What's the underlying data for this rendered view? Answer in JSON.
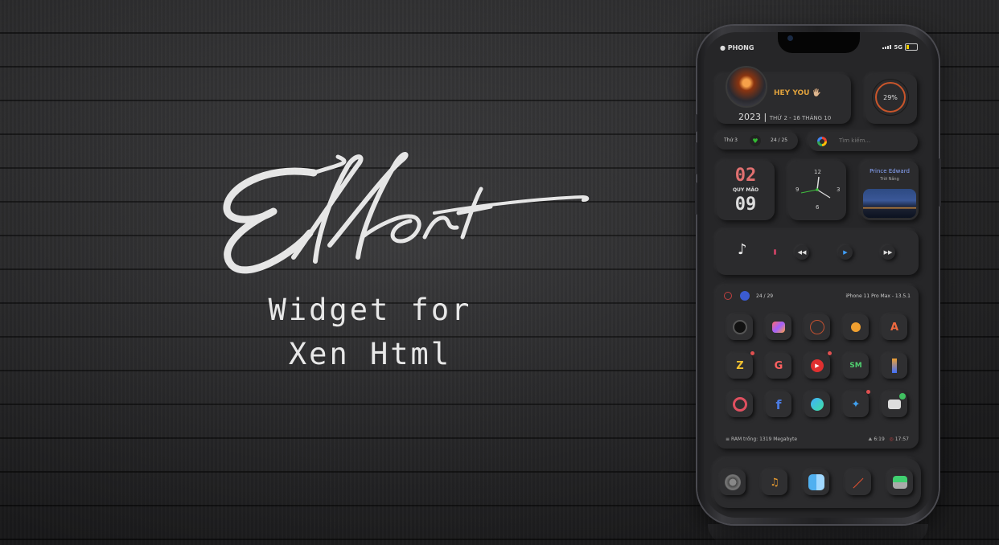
{
  "banner": {
    "logo_text": "Effort",
    "subtitle_line1": "Widget for",
    "subtitle_line2": "Xen Html"
  },
  "status_bar": {
    "carrier": "PHONG",
    "network": "5G",
    "apple_icon": "apple-icon",
    "signal_icon": "signal-bars-icon",
    "battery_icon": "battery-icon"
  },
  "profile_widget": {
    "greeting": "HEY YOU 🖐🏼",
    "year": "2023 |",
    "date_text": "THỨ 2 - 16 THÁNG 10"
  },
  "battery_widget": {
    "label": "29%",
    "level": 0.29
  },
  "stats_bar": {
    "day": "Thứ 3",
    "progress": "24 / 25"
  },
  "search": {
    "placeholder": "Tìm kiếm..."
  },
  "date_widget": {
    "day": "02",
    "month_label": "QUY MÃO",
    "year_short": "09"
  },
  "clock_widget": {
    "n12": "12",
    "n3": "3",
    "n6": "6",
    "n9": "9"
  },
  "weather_widget": {
    "city": "Prince Edward",
    "condition": "Trời Nắng"
  },
  "music_widget": {
    "note_icon": "music-note-icon",
    "prev_icon": "rewind-icon",
    "play_icon": "play-icon",
    "next_icon": "fast-forward-icon"
  },
  "app_panel": {
    "header_count": "24 / 29",
    "device": "iPhone 11 Pro Max - 13.5.1",
    "footer_ram": "RAM trống: 1319 Megabyte",
    "footer_time1": "6:19",
    "footer_time2": "17:57",
    "apps": [
      {
        "name": "camera-icon"
      },
      {
        "name": "photos-icon"
      },
      {
        "name": "clock-icon"
      },
      {
        "name": "weather-icon"
      },
      {
        "name": "appstore-icon"
      },
      {
        "name": "zing-icon"
      },
      {
        "name": "google-translate-icon"
      },
      {
        "name": "youtube-icon"
      },
      {
        "name": "sm-icon"
      },
      {
        "name": "paint-icon"
      },
      {
        "name": "settings-icon"
      },
      {
        "name": "facebook-icon"
      },
      {
        "name": "messenger-icon"
      },
      {
        "name": "twitter-icon"
      },
      {
        "name": "messages-icon"
      }
    ]
  },
  "dock": {
    "apps": [
      {
        "name": "dock-settings-icon"
      },
      {
        "name": "dock-music-icon"
      },
      {
        "name": "dock-finder-icon"
      },
      {
        "name": "dock-pen-icon"
      },
      {
        "name": "dock-toggle-icon"
      }
    ]
  },
  "colors": {
    "accent_orange": "#e0a23c",
    "ring": "#c8552b",
    "weather_text": "#8ba8ff"
  }
}
